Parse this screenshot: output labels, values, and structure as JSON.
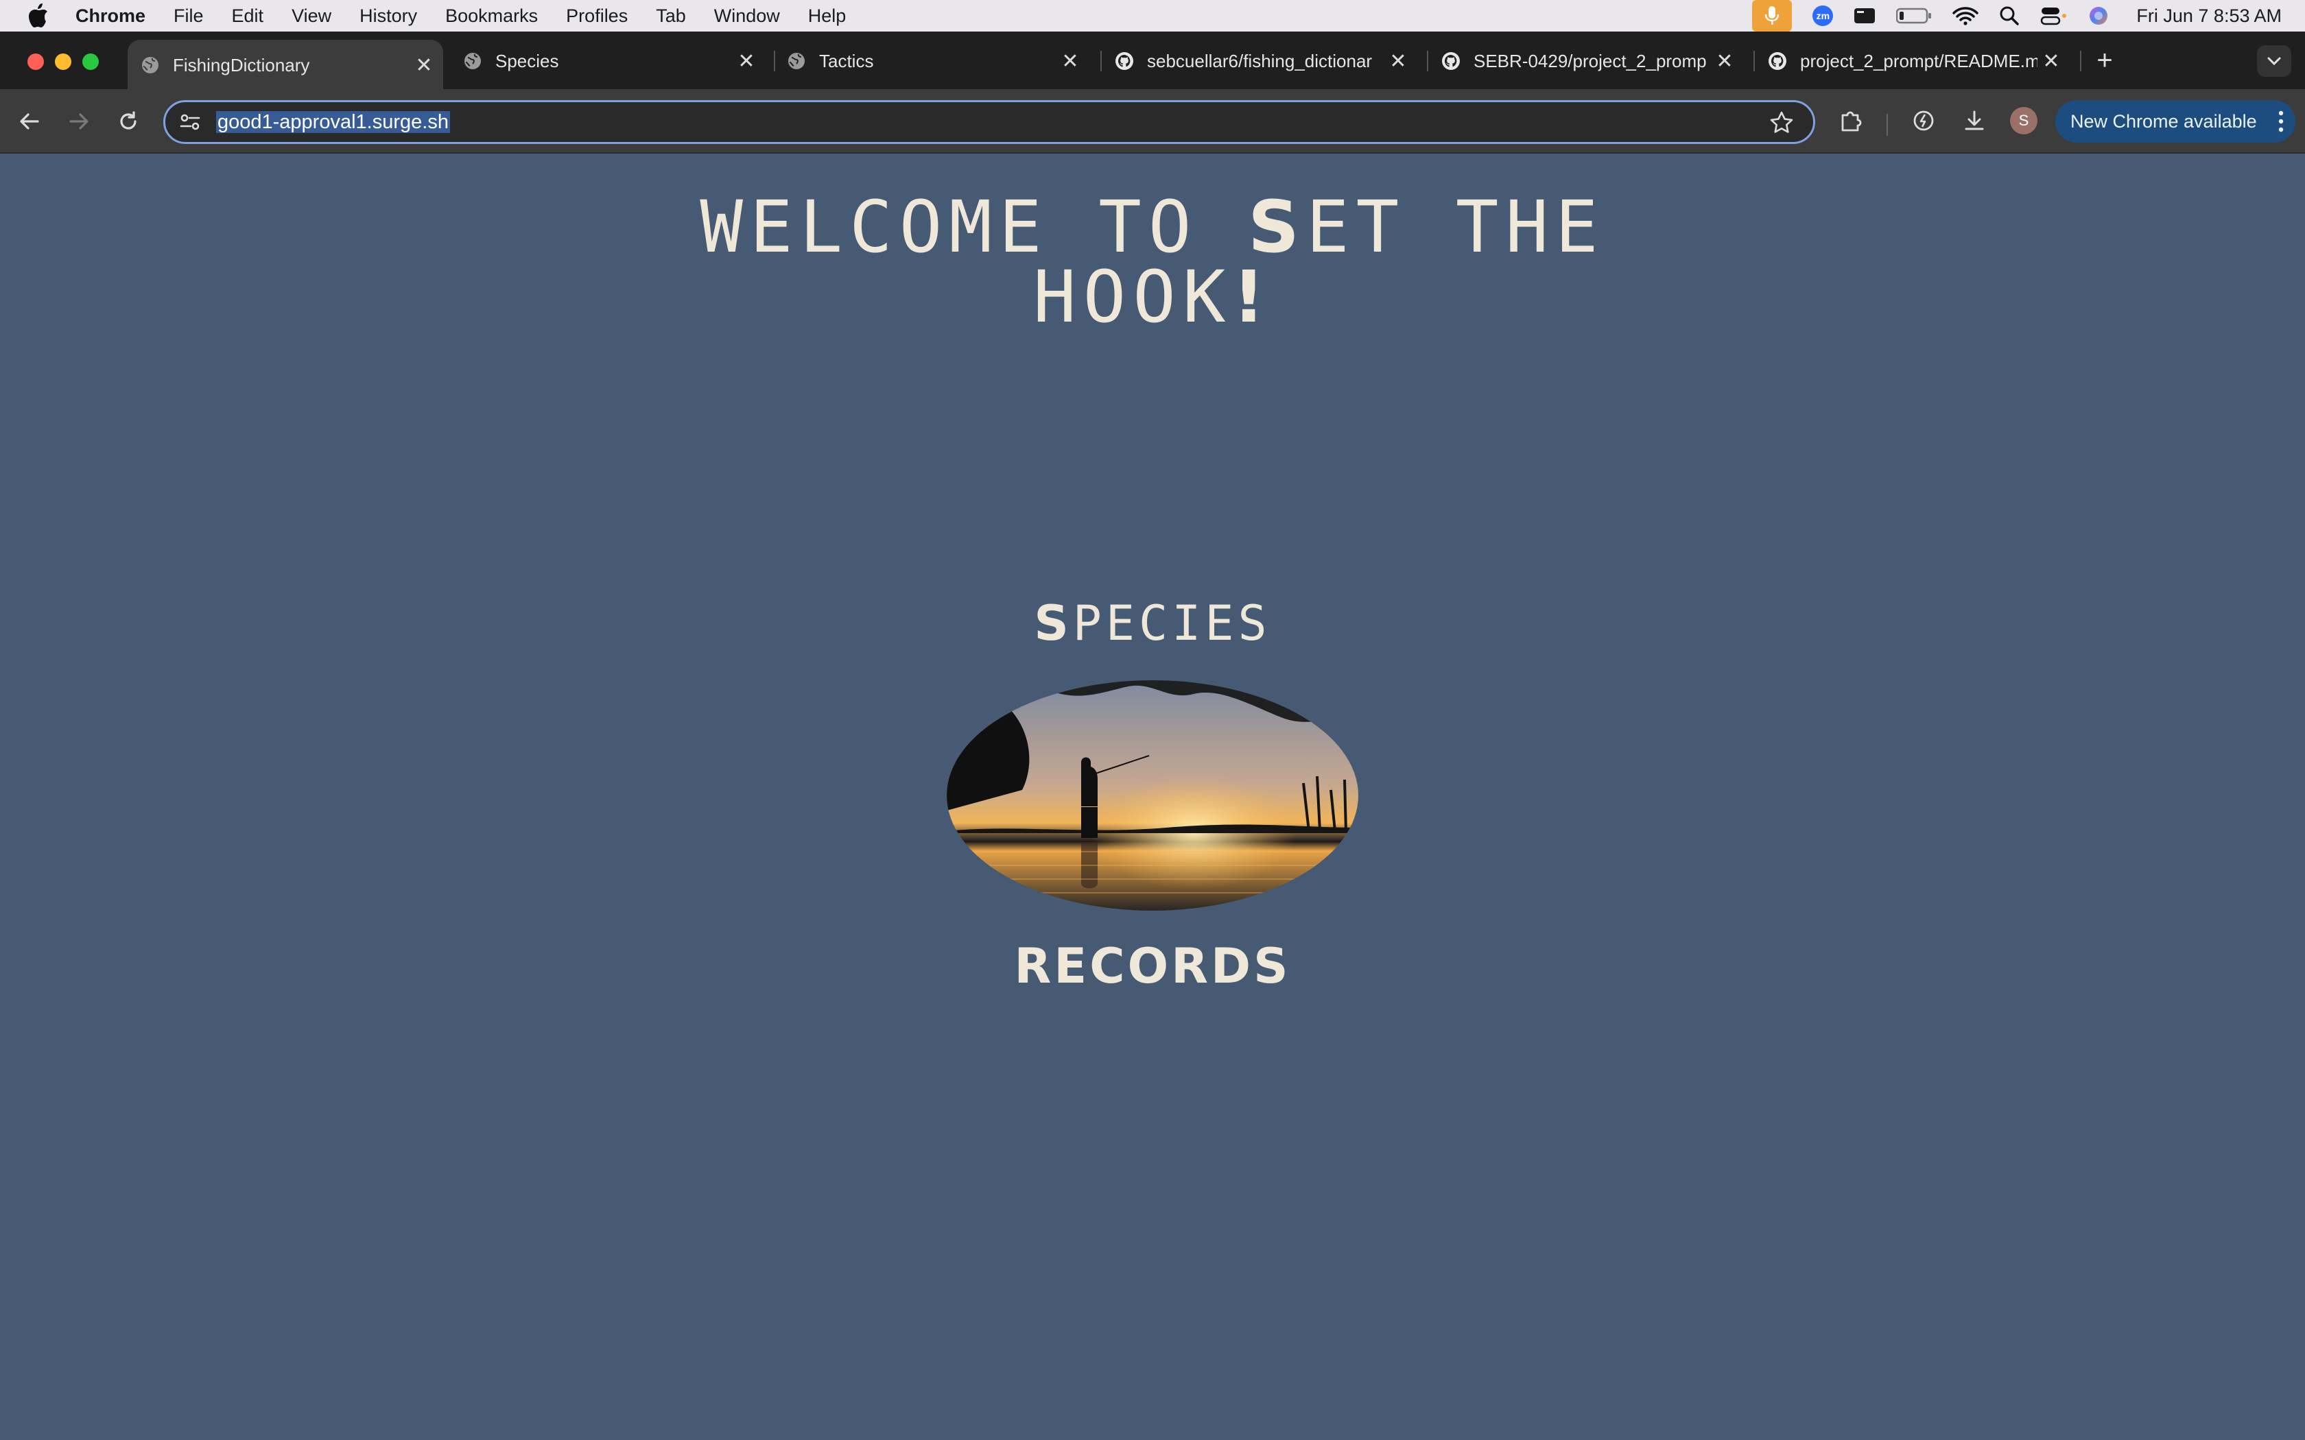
{
  "menubar": {
    "app_name": "Chrome",
    "items": [
      "File",
      "Edit",
      "View",
      "History",
      "Bookmarks",
      "Profiles",
      "Tab",
      "Window",
      "Help"
    ],
    "clock": "Fri Jun 7  8:53 AM",
    "icons": [
      "apple-icon",
      "microphone-icon",
      "zoom-icon",
      "screen-icon",
      "battery-icon",
      "wifi-icon",
      "spotlight-icon",
      "control-center-icon",
      "siri-icon"
    ]
  },
  "tabs": [
    {
      "title": "FishingDictionary",
      "favicon": "globe-icon",
      "active": true
    },
    {
      "title": "Species",
      "favicon": "globe-icon",
      "active": false
    },
    {
      "title": "Tactics",
      "favicon": "globe-icon",
      "active": false
    },
    {
      "title": "sebcuellar6/fishing_dictionar",
      "favicon": "github-icon",
      "active": false
    },
    {
      "title": "SEBR-0429/project_2_promp",
      "favicon": "github-icon",
      "active": false
    },
    {
      "title": "project_2_prompt/README.m",
      "favicon": "github-icon",
      "active": false
    }
  ],
  "toolbar": {
    "url": "good1-approval1.surge.sh",
    "profile_initial": "S",
    "update_label": "New Chrome available"
  },
  "page": {
    "headline_line1_a": "WELCOME TO ",
    "headline_line1_b": "S",
    "headline_line1_c": "ET THE",
    "headline_line2_a": "HOOK",
    "headline_line2_b": "!",
    "species_link_a": "S",
    "species_link_b": "PECIES",
    "records_link": "RECORDS",
    "hero_image": "fisherman-at-sunset-photo"
  },
  "colors": {
    "page_background": "#465a74",
    "page_text": "#efe8d8",
    "update_button": "#1d4d7e",
    "omnibox_focus": "#7ea2df"
  }
}
